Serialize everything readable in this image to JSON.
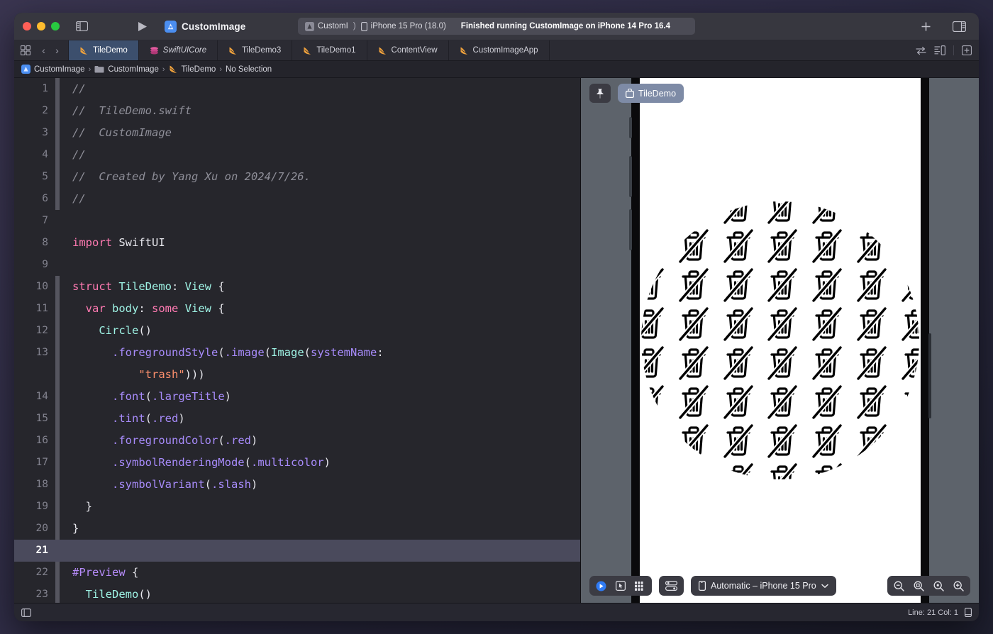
{
  "window": {
    "title": "CustomImage"
  },
  "toolbar": {
    "scheme_name": "CustomImage",
    "status": {
      "scheme_chip": "CustomI",
      "separator": ")",
      "destination": "iPhone 15 Pro (18.0)",
      "message": "Finished running CustomImage on iPhone 14 Pro 16.4"
    },
    "icons": {
      "sidebar_toggle": "sidebar-toggle-icon",
      "run": "run-play-icon",
      "add": "plus-icon",
      "inspector_toggle": "inspector-toggle-icon"
    }
  },
  "tabbar": {
    "back_label": "‹",
    "forward_label": "›",
    "tabs": [
      {
        "label": "TileDemo",
        "icon": "swift-file-icon",
        "active": true,
        "italic": false
      },
      {
        "label": "SwiftUICore",
        "icon": "module-icon",
        "active": false,
        "italic": true
      },
      {
        "label": "TileDemo3",
        "icon": "swift-file-icon",
        "active": false,
        "italic": false
      },
      {
        "label": "TileDemo1",
        "icon": "swift-file-icon",
        "active": false,
        "italic": false
      },
      {
        "label": "ContentView",
        "icon": "swift-file-icon",
        "active": false,
        "italic": false
      },
      {
        "label": "CustomImageApp",
        "icon": "swift-file-icon",
        "active": false,
        "italic": false
      }
    ]
  },
  "breadcrumb": {
    "items": [
      "CustomImage",
      "CustomImage",
      "TileDemo",
      "No Selection"
    ],
    "separator": "›"
  },
  "editor": {
    "current_line": 21,
    "lines": [
      {
        "n": 1,
        "changed": true,
        "tokens": [
          {
            "t": "//",
            "c": "cmt"
          }
        ]
      },
      {
        "n": 2,
        "changed": true,
        "tokens": [
          {
            "t": "//  TileDemo.swift",
            "c": "cmt"
          }
        ]
      },
      {
        "n": 3,
        "changed": true,
        "tokens": [
          {
            "t": "//  CustomImage",
            "c": "cmt"
          }
        ]
      },
      {
        "n": 4,
        "changed": true,
        "tokens": [
          {
            "t": "//",
            "c": "cmt"
          }
        ]
      },
      {
        "n": 5,
        "changed": true,
        "tokens": [
          {
            "t": "//  Created by Yang Xu on 2024/7/26.",
            "c": "cmt"
          }
        ]
      },
      {
        "n": 6,
        "changed": true,
        "tokens": [
          {
            "t": "//",
            "c": "cmt"
          }
        ]
      },
      {
        "n": 7,
        "changed": false,
        "tokens": []
      },
      {
        "n": 8,
        "changed": false,
        "tokens": [
          {
            "t": "import",
            "c": "kw"
          },
          {
            "t": " SwiftUI",
            "c": "pln"
          }
        ]
      },
      {
        "n": 9,
        "changed": false,
        "tokens": []
      },
      {
        "n": 10,
        "changed": true,
        "tokens": [
          {
            "t": "struct",
            "c": "kw"
          },
          {
            "t": " ",
            "c": "pln"
          },
          {
            "t": "TileDemo",
            "c": "typ"
          },
          {
            "t": ": ",
            "c": "pln"
          },
          {
            "t": "View",
            "c": "typ"
          },
          {
            "t": " {",
            "c": "pln"
          }
        ]
      },
      {
        "n": 11,
        "changed": true,
        "tokens": [
          {
            "t": "  ",
            "c": "pln"
          },
          {
            "t": "var",
            "c": "kw"
          },
          {
            "t": " ",
            "c": "pln"
          },
          {
            "t": "body",
            "c": "typ"
          },
          {
            "t": ": ",
            "c": "pln"
          },
          {
            "t": "some",
            "c": "kw"
          },
          {
            "t": " ",
            "c": "pln"
          },
          {
            "t": "View",
            "c": "typ"
          },
          {
            "t": " {",
            "c": "pln"
          }
        ]
      },
      {
        "n": 12,
        "changed": true,
        "tokens": [
          {
            "t": "    ",
            "c": "pln"
          },
          {
            "t": "Circle",
            "c": "typ"
          },
          {
            "t": "()",
            "c": "pln"
          }
        ]
      },
      {
        "n": 13,
        "changed": true,
        "tokens": [
          {
            "t": "      ",
            "c": "pln"
          },
          {
            "t": ".foregroundStyle",
            "c": "mth"
          },
          {
            "t": "(",
            "c": "pln"
          },
          {
            "t": ".image",
            "c": "mth"
          },
          {
            "t": "(",
            "c": "pln"
          },
          {
            "t": "Image",
            "c": "typ"
          },
          {
            "t": "(",
            "c": "pln"
          },
          {
            "t": "systemName",
            "c": "mth"
          },
          {
            "t": ":",
            "c": "pln"
          }
        ]
      },
      {
        "n": 13.5,
        "wrap": true,
        "changed": true,
        "tokens": [
          {
            "t": "          ",
            "c": "pln"
          },
          {
            "t": "\"trash\"",
            "c": "str"
          },
          {
            "t": ")))",
            "c": "pln"
          }
        ]
      },
      {
        "n": 14,
        "changed": true,
        "tokens": [
          {
            "t": "      ",
            "c": "pln"
          },
          {
            "t": ".font",
            "c": "mth"
          },
          {
            "t": "(",
            "c": "pln"
          },
          {
            "t": ".largeTitle",
            "c": "mth"
          },
          {
            "t": ")",
            "c": "pln"
          }
        ]
      },
      {
        "n": 15,
        "changed": true,
        "tokens": [
          {
            "t": "      ",
            "c": "pln"
          },
          {
            "t": ".tint",
            "c": "mth"
          },
          {
            "t": "(",
            "c": "pln"
          },
          {
            "t": ".red",
            "c": "mth"
          },
          {
            "t": ")",
            "c": "pln"
          }
        ]
      },
      {
        "n": 16,
        "changed": true,
        "tokens": [
          {
            "t": "      ",
            "c": "pln"
          },
          {
            "t": ".foregroundColor",
            "c": "mth"
          },
          {
            "t": "(",
            "c": "pln"
          },
          {
            "t": ".red",
            "c": "mth"
          },
          {
            "t": ")",
            "c": "pln"
          }
        ]
      },
      {
        "n": 17,
        "changed": true,
        "tokens": [
          {
            "t": "      ",
            "c": "pln"
          },
          {
            "t": ".symbolRenderingMode",
            "c": "mth"
          },
          {
            "t": "(",
            "c": "pln"
          },
          {
            "t": ".multicolor",
            "c": "mth"
          },
          {
            "t": ")",
            "c": "pln"
          }
        ]
      },
      {
        "n": 18,
        "changed": true,
        "tokens": [
          {
            "t": "      ",
            "c": "pln"
          },
          {
            "t": ".symbolVariant",
            "c": "mth"
          },
          {
            "t": "(",
            "c": "pln"
          },
          {
            "t": ".slash",
            "c": "mth"
          },
          {
            "t": ")",
            "c": "pln"
          }
        ]
      },
      {
        "n": 19,
        "changed": true,
        "tokens": [
          {
            "t": "  }",
            "c": "pln"
          }
        ]
      },
      {
        "n": 20,
        "changed": true,
        "tokens": [
          {
            "t": "}",
            "c": "pln"
          }
        ]
      },
      {
        "n": 21,
        "changed": false,
        "tokens": []
      },
      {
        "n": 22,
        "changed": true,
        "tokens": [
          {
            "t": "#Preview",
            "c": "mac"
          },
          {
            "t": " {",
            "c": "pln"
          }
        ]
      },
      {
        "n": 23,
        "changed": true,
        "tokens": [
          {
            "t": "  ",
            "c": "pln"
          },
          {
            "t": "TileDemo",
            "c": "typ"
          },
          {
            "t": "()",
            "c": "pln"
          }
        ]
      }
    ]
  },
  "canvas": {
    "pin_icon": "pin-icon",
    "preview_chip_label": "TileDemo",
    "preview_chip_icon": "preview-bag-icon",
    "preview": {
      "shape": "circle",
      "fill": "tiled-symbol-image",
      "symbol": "trash.slash",
      "symbol_color": "#000000",
      "background": "#ffffff",
      "tile_columns": 7,
      "tile_rows": 8
    },
    "bottom_toolbar": {
      "live_preview_label": "live-preview-icon",
      "selectable_label": "selectable-icon",
      "variants_label": "variants-icon",
      "device_settings_label": "device-settings-icon",
      "device_select": "Automatic – iPhone 15 Pro",
      "device_select_chevron": "⌄",
      "zoom_out": "zoom-out-icon",
      "zoom_fit": "zoom-fit-icon",
      "zoom_actual": "zoom-actual-icon",
      "zoom_in": "zoom-in-icon"
    }
  },
  "statusbar": {
    "left_icon": "minimap-toggle-icon",
    "line_col": "Line: 21  Col: 1",
    "right_icon": "device-icon"
  },
  "colors": {
    "accent_blue": "#4b8ef0",
    "active_tab": "#3c4f6d",
    "keyword": "#ff7ab2",
    "type": "#9ef2e4",
    "method": "#a78bfa",
    "string": "#fc8f6c",
    "comment": "#8e8e98",
    "canvas_bg": "#5d636b"
  }
}
